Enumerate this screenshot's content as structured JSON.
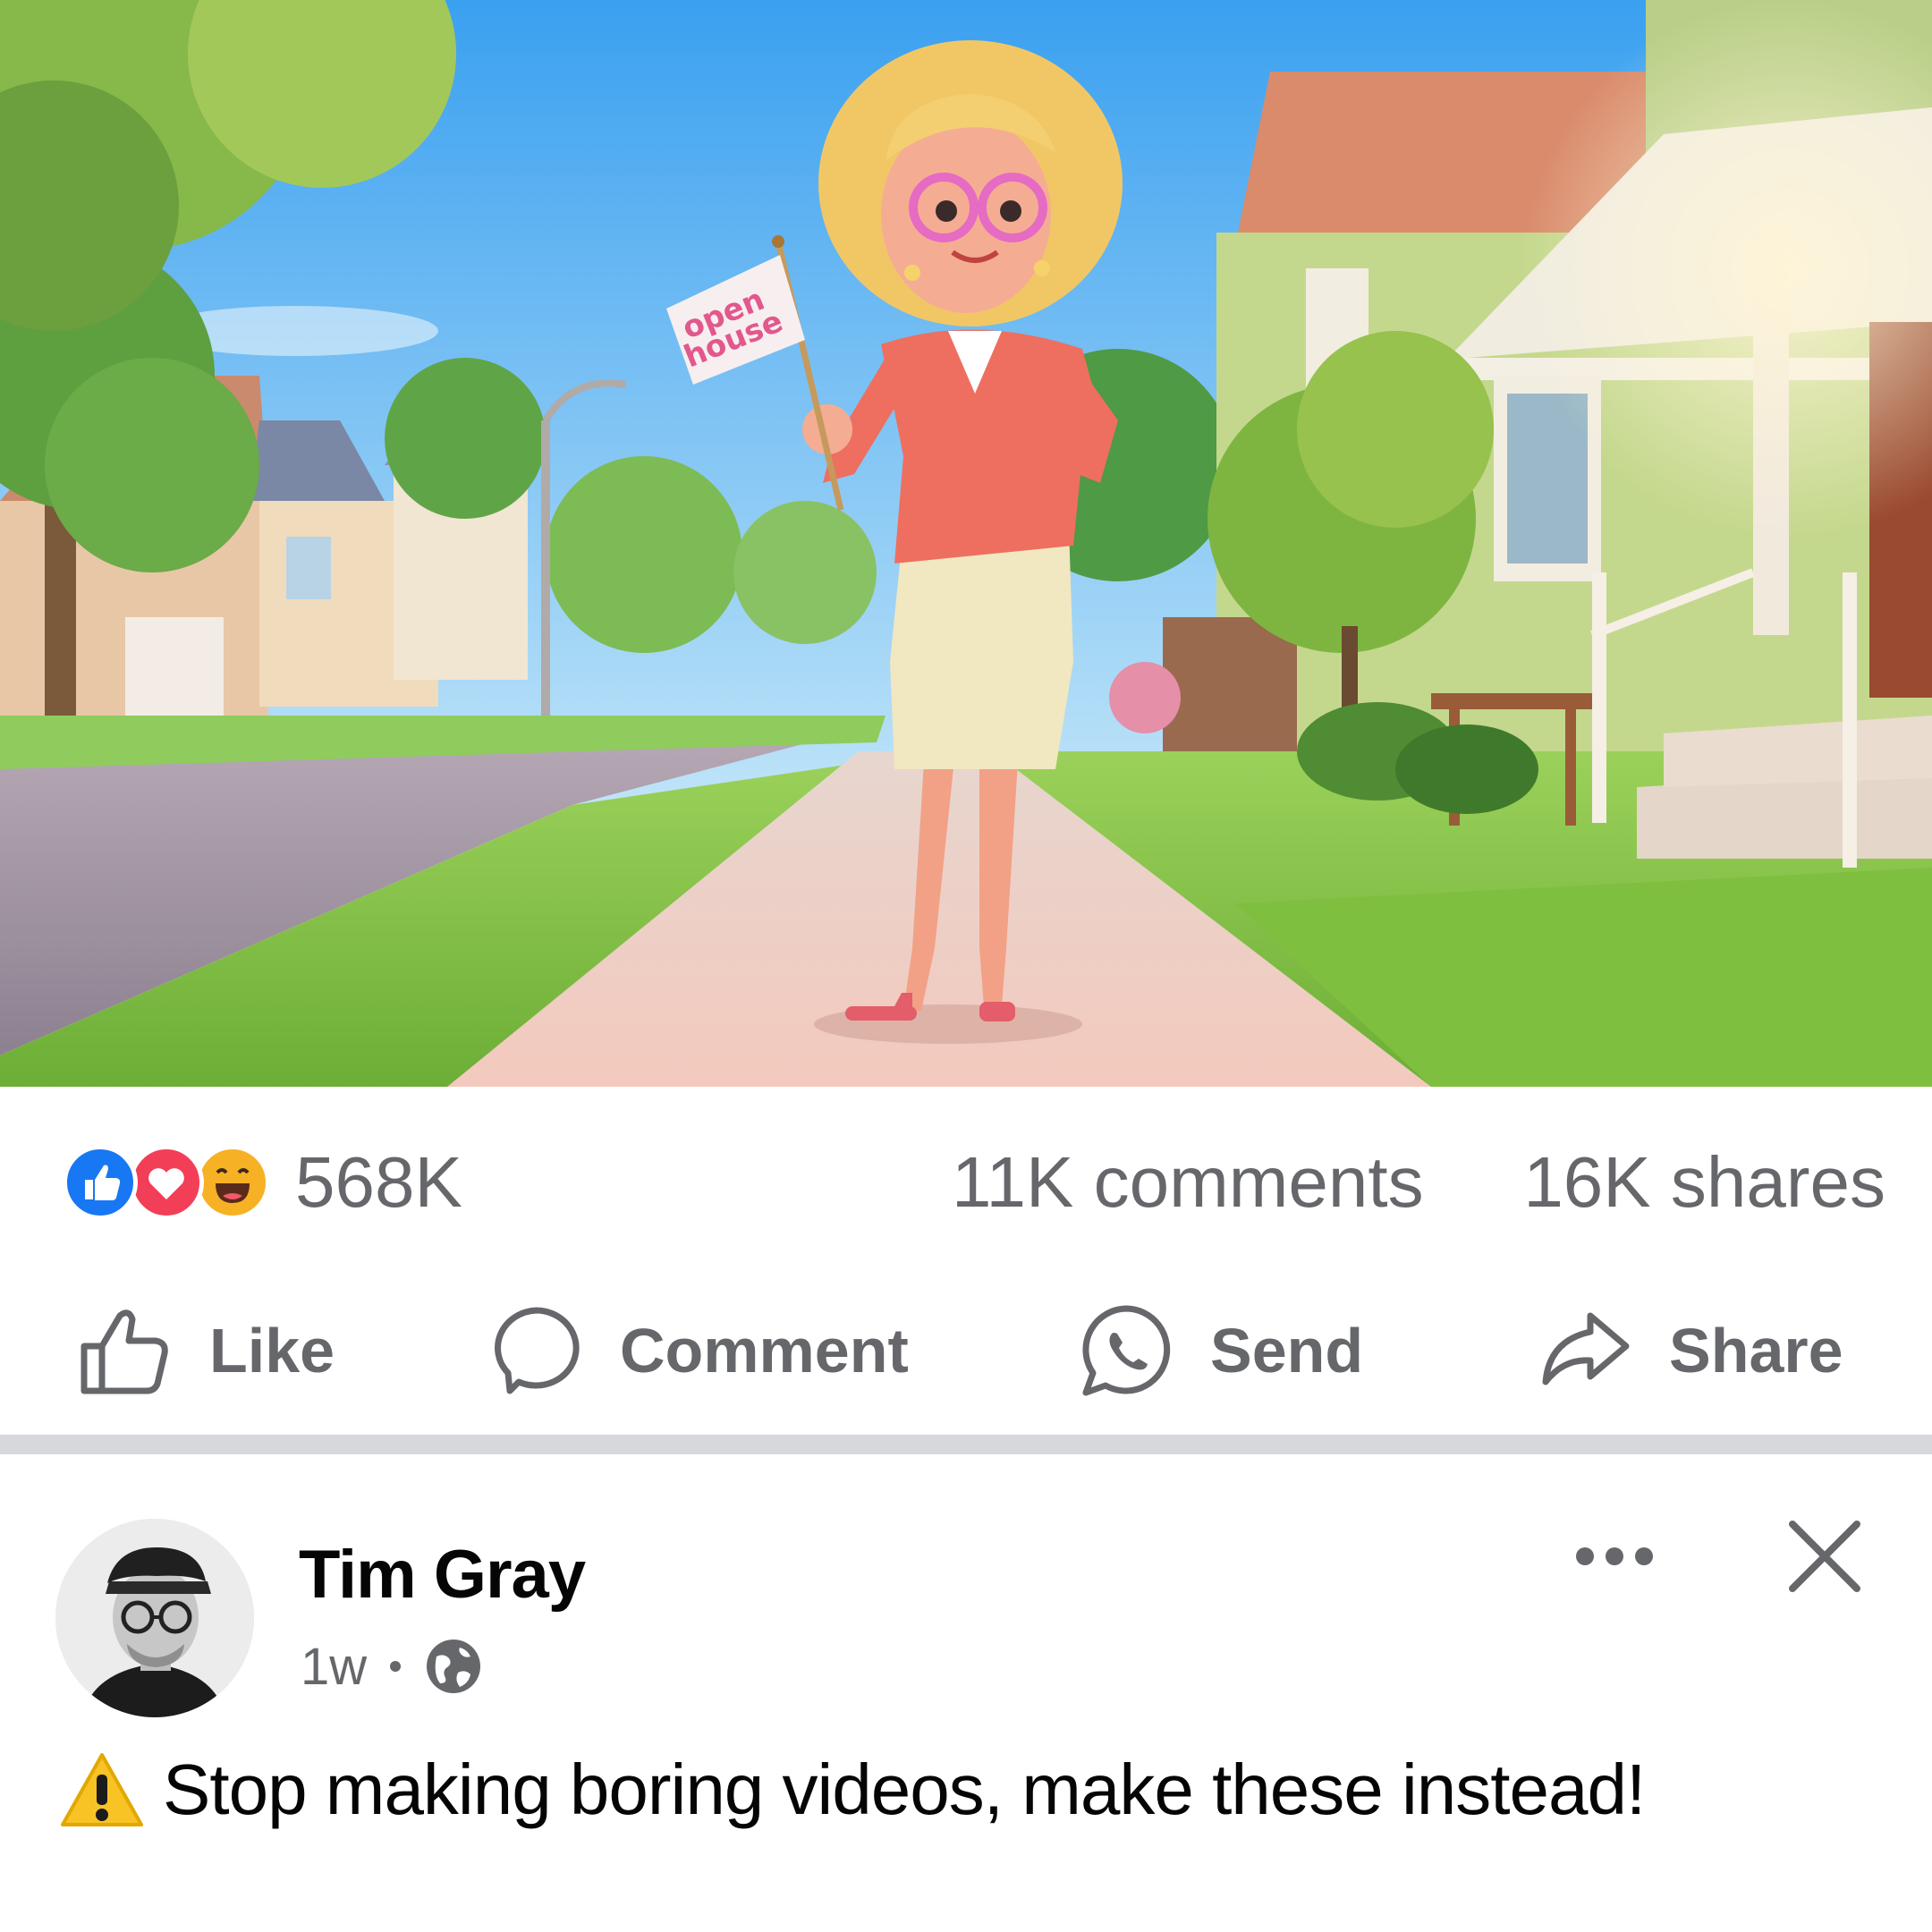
{
  "post_image": {
    "flag_text_line1": "open",
    "flag_text_line2": "house"
  },
  "stats": {
    "reaction_icons": [
      "like-reaction-icon",
      "love-reaction-icon",
      "haha-reaction-icon"
    ],
    "reaction_count": "568K",
    "comments": "11K comments",
    "shares": "16K shares"
  },
  "actions": {
    "like_label": "Like",
    "comment_label": "Comment",
    "send_label": "Send",
    "share_label": "Share"
  },
  "next_post": {
    "author": "Tim Gray",
    "time": "1w",
    "privacy_icon": "globe-icon",
    "caption_icon": "warning-icon",
    "caption": "Stop making boring videos, make these instead!"
  },
  "colors": {
    "icon_gray": "#65676b",
    "like_blue": "#1877f2",
    "love_red": "#f33e58",
    "haha_yellow": "#f7b125",
    "divider": "#d6d8db"
  }
}
